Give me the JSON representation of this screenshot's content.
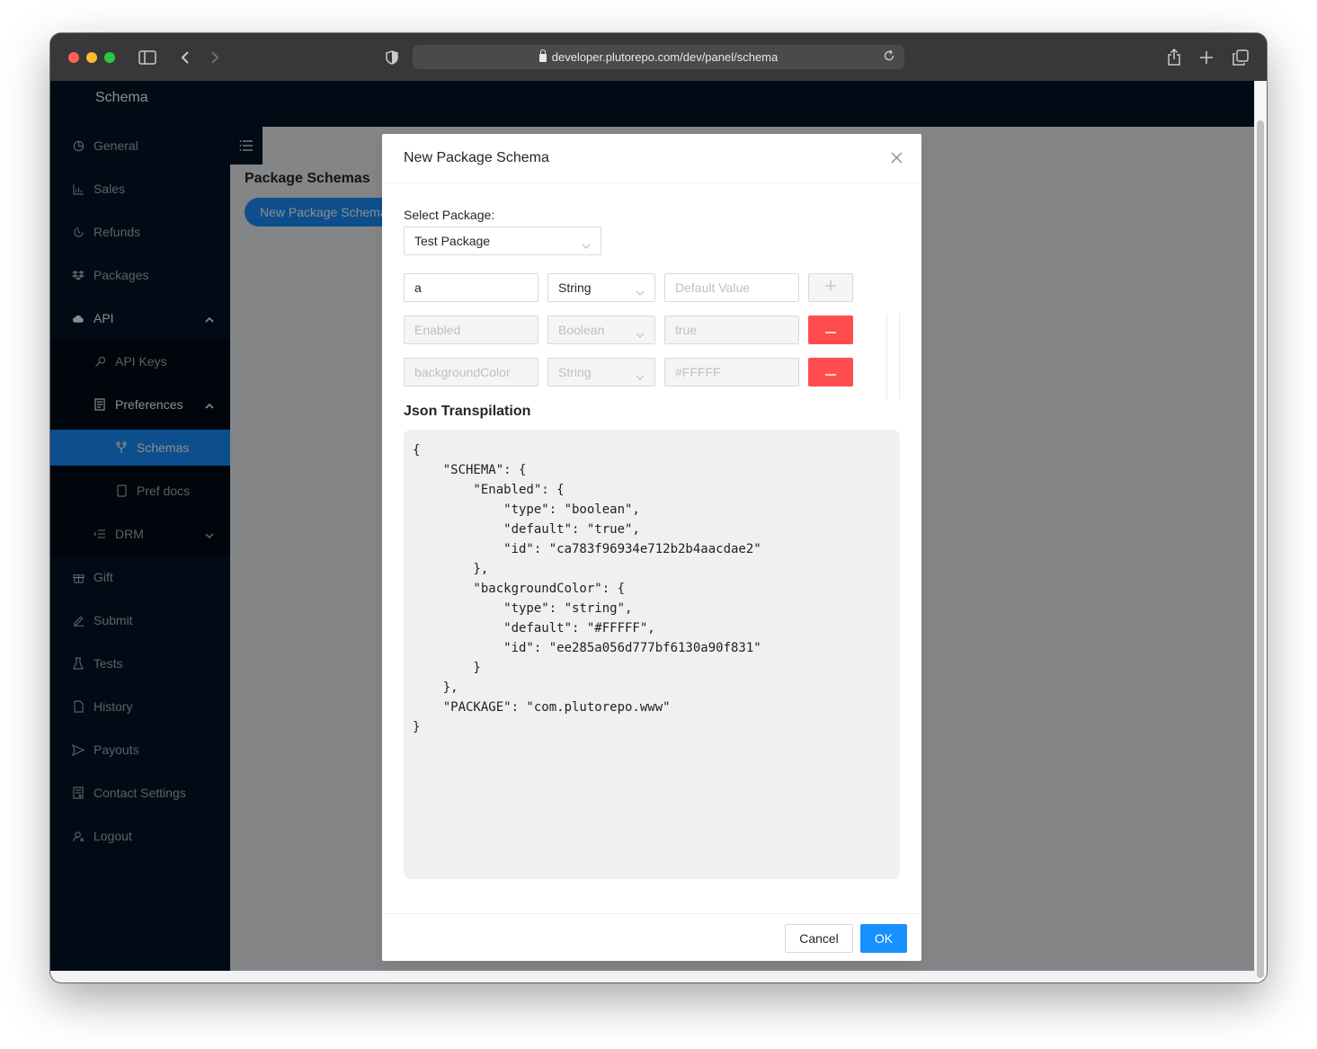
{
  "browser": {
    "url": "developer.plutorepo.com/dev/panel/schema"
  },
  "sidebar": {
    "title": "Schema",
    "items": [
      {
        "label": "General",
        "icon": "pie-chart-icon"
      },
      {
        "label": "Sales",
        "icon": "bar-chart-icon"
      },
      {
        "label": "Refunds",
        "icon": "refund-icon"
      },
      {
        "label": "Packages",
        "icon": "dropbox-icon"
      },
      {
        "label": "API",
        "icon": "cloud-icon"
      },
      {
        "label": "API Keys",
        "icon": "key-icon"
      },
      {
        "label": "Preferences",
        "icon": "preferences-icon"
      },
      {
        "label": "Schemas",
        "icon": "fork-icon"
      },
      {
        "label": "Pref docs",
        "icon": "file-icon"
      },
      {
        "label": "DRM",
        "icon": "drm-icon"
      },
      {
        "label": "Gift",
        "icon": "gift-icon"
      },
      {
        "label": "Submit",
        "icon": "edit-icon"
      },
      {
        "label": "Tests",
        "icon": "experiment-icon"
      },
      {
        "label": "History",
        "icon": "history-icon"
      },
      {
        "label": "Payouts",
        "icon": "send-icon"
      },
      {
        "label": "Contact Settings",
        "icon": "contact-icon"
      },
      {
        "label": "Logout",
        "icon": "logout-icon"
      }
    ]
  },
  "content": {
    "title": "Package Schemas",
    "new_button": "New Package Schema"
  },
  "modal": {
    "title": "New Package Schema",
    "select_label": "Select Package:",
    "selected_package": "Test Package",
    "new_row": {
      "key_value": "a",
      "type": "String",
      "default_placeholder": "Default Value"
    },
    "rows": [
      {
        "key": "Enabled",
        "type": "Boolean",
        "default": "true"
      },
      {
        "key": "backgroundColor",
        "type": "String",
        "default": "#FFFFF"
      }
    ],
    "json_title": "Json Transpilation",
    "json_text": "{\n    \"SCHEMA\": {\n        \"Enabled\": {\n            \"type\": \"boolean\",\n            \"default\": \"true\",\n            \"id\": \"ca783f96934e712b2b4aacdae2\"\n        },\n        \"backgroundColor\": {\n            \"type\": \"string\",\n            \"default\": \"#FFFFF\",\n            \"id\": \"ee285a056d777bf6130a90f831\"\n        }\n    },\n    \"PACKAGE\": \"com.plutorepo.www\"\n}",
    "cancel_label": "Cancel",
    "ok_label": "OK"
  },
  "colors": {
    "primary": "#1890ff",
    "danger": "#ff4d4f",
    "sidebar_bg": "#001529"
  }
}
